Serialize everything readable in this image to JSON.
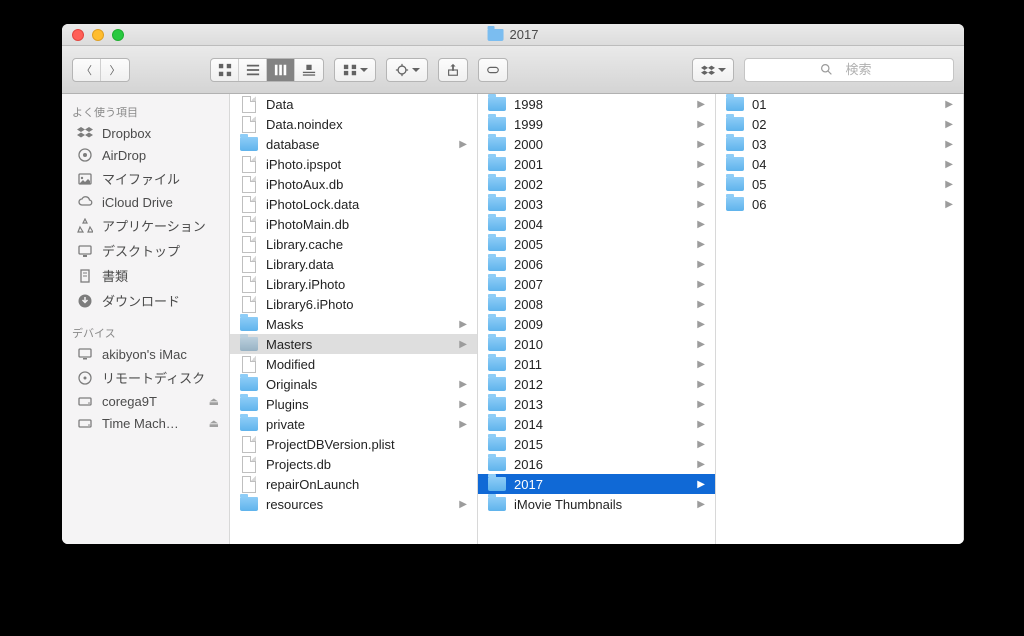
{
  "window": {
    "title": "2017"
  },
  "search": {
    "placeholder": "検索"
  },
  "sidebar": {
    "sections": [
      {
        "header": "よく使う項目",
        "items": [
          {
            "icon": "dropbox",
            "label": "Dropbox"
          },
          {
            "icon": "airdrop",
            "label": "AirDrop"
          },
          {
            "icon": "myfiles",
            "label": "マイファイル"
          },
          {
            "icon": "icloud",
            "label": "iCloud Drive"
          },
          {
            "icon": "apps",
            "label": "アプリケーション"
          },
          {
            "icon": "desktop",
            "label": "デスクトップ"
          },
          {
            "icon": "docs",
            "label": "書類"
          },
          {
            "icon": "downloads",
            "label": "ダウンロード"
          }
        ]
      },
      {
        "header": "デバイス",
        "items": [
          {
            "icon": "imac",
            "label": "akibyon's iMac"
          },
          {
            "icon": "disc",
            "label": "リモートディスク"
          },
          {
            "icon": "drive",
            "label": "corega9T",
            "eject": true
          },
          {
            "icon": "drive",
            "label": "Time Mach…",
            "eject": true
          }
        ]
      }
    ]
  },
  "columns": [
    {
      "items": [
        {
          "type": "file",
          "name": "Data"
        },
        {
          "type": "file",
          "name": "Data.noindex"
        },
        {
          "type": "folder",
          "name": "database",
          "expandable": true
        },
        {
          "type": "file",
          "name": "iPhoto.ipspot"
        },
        {
          "type": "file",
          "name": "iPhotoAux.db"
        },
        {
          "type": "file",
          "name": "iPhotoLock.data"
        },
        {
          "type": "file",
          "name": "iPhotoMain.db"
        },
        {
          "type": "file",
          "name": "Library.cache"
        },
        {
          "type": "file",
          "name": "Library.data"
        },
        {
          "type": "file",
          "name": "Library.iPhoto"
        },
        {
          "type": "file",
          "name": "Library6.iPhoto"
        },
        {
          "type": "folder",
          "name": "Masks",
          "expandable": true
        },
        {
          "type": "folder",
          "name": "Masters",
          "expandable": true,
          "selected": "gray"
        },
        {
          "type": "file",
          "name": "Modified"
        },
        {
          "type": "folder",
          "name": "Originals",
          "expandable": true
        },
        {
          "type": "folder",
          "name": "Plugins",
          "expandable": true
        },
        {
          "type": "folder",
          "name": "private",
          "expandable": true
        },
        {
          "type": "file",
          "name": "ProjectDBVersion.plist"
        },
        {
          "type": "file",
          "name": "Projects.db"
        },
        {
          "type": "file",
          "name": "repairOnLaunch"
        },
        {
          "type": "folder",
          "name": "resources",
          "expandable": true
        }
      ]
    },
    {
      "items": [
        {
          "type": "folder",
          "name": "1998",
          "expandable": true
        },
        {
          "type": "folder",
          "name": "1999",
          "expandable": true
        },
        {
          "type": "folder",
          "name": "2000",
          "expandable": true
        },
        {
          "type": "folder",
          "name": "2001",
          "expandable": true
        },
        {
          "type": "folder",
          "name": "2002",
          "expandable": true
        },
        {
          "type": "folder",
          "name": "2003",
          "expandable": true
        },
        {
          "type": "folder",
          "name": "2004",
          "expandable": true
        },
        {
          "type": "folder",
          "name": "2005",
          "expandable": true
        },
        {
          "type": "folder",
          "name": "2006",
          "expandable": true
        },
        {
          "type": "folder",
          "name": "2007",
          "expandable": true
        },
        {
          "type": "folder",
          "name": "2008",
          "expandable": true
        },
        {
          "type": "folder",
          "name": "2009",
          "expandable": true
        },
        {
          "type": "folder",
          "name": "2010",
          "expandable": true
        },
        {
          "type": "folder",
          "name": "2011",
          "expandable": true
        },
        {
          "type": "folder",
          "name": "2012",
          "expandable": true
        },
        {
          "type": "folder",
          "name": "2013",
          "expandable": true
        },
        {
          "type": "folder",
          "name": "2014",
          "expandable": true
        },
        {
          "type": "folder",
          "name": "2015",
          "expandable": true
        },
        {
          "type": "folder",
          "name": "2016",
          "expandable": true
        },
        {
          "type": "folder",
          "name": "2017",
          "expandable": true,
          "selected": "blue"
        },
        {
          "type": "folder",
          "name": "iMovie Thumbnails",
          "expandable": true
        }
      ]
    },
    {
      "items": [
        {
          "type": "folder",
          "name": "01",
          "expandable": true
        },
        {
          "type": "folder",
          "name": "02",
          "expandable": true
        },
        {
          "type": "folder",
          "name": "03",
          "expandable": true
        },
        {
          "type": "folder",
          "name": "04",
          "expandable": true
        },
        {
          "type": "folder",
          "name": "05",
          "expandable": true
        },
        {
          "type": "folder",
          "name": "06",
          "expandable": true
        }
      ]
    }
  ]
}
